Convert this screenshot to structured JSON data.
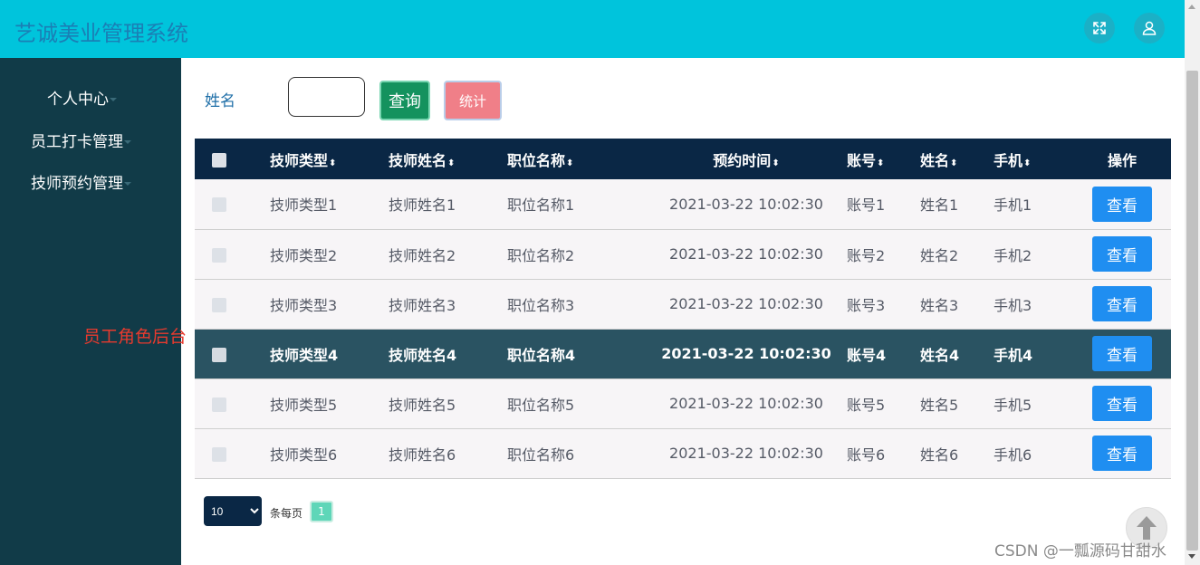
{
  "header": {
    "title": "艺诚美业管理系统",
    "fullscreen_icon": "fullscreen-icon",
    "user_icon": "user-icon",
    "bg_color": "#00c4dc"
  },
  "sidebar": {
    "items": [
      {
        "label": "个人中心"
      },
      {
        "label": "员工打卡管理"
      },
      {
        "label": "技师预约管理"
      }
    ]
  },
  "note": "员工角色后台",
  "search": {
    "label": "姓名",
    "value": "",
    "query_button": "查询",
    "stat_button": "统计"
  },
  "table": {
    "headers": [
      "技师类型",
      "技师姓名",
      "职位名称",
      "预约时间",
      "账号",
      "姓名",
      "手机",
      "操作"
    ],
    "sort_icon": "⬍",
    "rows": [
      {
        "type": "技师类型1",
        "tech": "技师姓名1",
        "position": "职位名称1",
        "time": "2021-03-22 10:02:30",
        "account": "账号1",
        "name": "姓名1",
        "phone": "手机1",
        "action": "查看"
      },
      {
        "type": "技师类型2",
        "tech": "技师姓名2",
        "position": "职位名称2",
        "time": "2021-03-22 10:02:30",
        "account": "账号2",
        "name": "姓名2",
        "phone": "手机2",
        "action": "查看"
      },
      {
        "type": "技师类型3",
        "tech": "技师姓名3",
        "position": "职位名称3",
        "time": "2021-03-22 10:02:30",
        "account": "账号3",
        "name": "姓名3",
        "phone": "手机3",
        "action": "查看"
      },
      {
        "type": "技师类型4",
        "tech": "技师姓名4",
        "position": "职位名称4",
        "time": "2021-03-22 10:02:30",
        "account": "账号4",
        "name": "姓名4",
        "phone": "手机4",
        "action": "查看"
      },
      {
        "type": "技师类型5",
        "tech": "技师姓名5",
        "position": "职位名称5",
        "time": "2021-03-22 10:02:30",
        "account": "账号5",
        "name": "姓名5",
        "phone": "手机5",
        "action": "查看"
      },
      {
        "type": "技师类型6",
        "tech": "技师姓名6",
        "position": "职位名称6",
        "time": "2021-03-22 10:02:30",
        "account": "账号6",
        "name": "姓名6",
        "phone": "手机6",
        "action": "查看"
      }
    ],
    "highlighted_row": 3
  },
  "pagination": {
    "page_size": "10",
    "page_size_options": [
      "10"
    ],
    "per_page_label": "条每页",
    "current_page": "1"
  },
  "watermark": "CSDN @一瓢源码甘甜水",
  "colors": {
    "sidebar": "#113b48",
    "table_header": "#0a2745",
    "highlight_row": "#2a5362",
    "view_button": "#1f8ef1",
    "query_button": "#14925e",
    "stat_button": "#f07f88"
  }
}
